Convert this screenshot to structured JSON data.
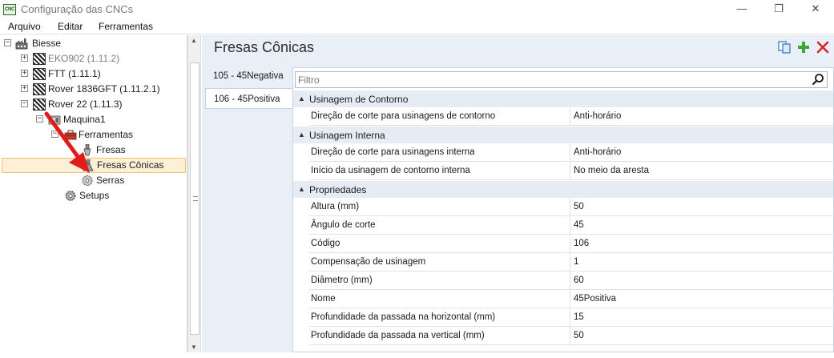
{
  "window": {
    "title": "Configuração das CNCs",
    "app_icon_text": "CNC",
    "minimize_glyph": "—",
    "restore_glyph": "❐",
    "close_glyph": "✕"
  },
  "menu": {
    "items": [
      {
        "label": "Arquivo"
      },
      {
        "label": "Editar"
      },
      {
        "label": "Ferramentas"
      }
    ]
  },
  "tree": {
    "nodes": [
      {
        "label": "Biesse",
        "expander": "−",
        "icon": "factory-icon"
      },
      {
        "label": "EKO902 (1.11.2)",
        "expander": "+",
        "icon": "machine-icon",
        "muted": true
      },
      {
        "label": "FTT (1.11.1)",
        "expander": "+",
        "icon": "machine-icon"
      },
      {
        "label": "Rover 1836GFT (1.11.2.1)",
        "expander": "+",
        "icon": "machine-icon"
      },
      {
        "label": "Rover 22 (1.11.3)",
        "expander": "−",
        "icon": "machine-icon"
      },
      {
        "label": "Maquina1",
        "expander": "−",
        "icon": "machine-config-icon"
      },
      {
        "label": "Ferramentas",
        "expander": "−",
        "icon": "toolbox-icon"
      },
      {
        "label": "Fresas",
        "icon": "router-bit-icon"
      },
      {
        "label": "Fresas Cônicas",
        "icon": "conical-bit-icon",
        "selected": true
      },
      {
        "label": "Serras",
        "icon": "saw-blade-icon"
      },
      {
        "label": "Setups",
        "icon": "gear-icon"
      }
    ]
  },
  "main": {
    "title": "Fresas Cônicas",
    "toolbar": {
      "copy_icon": "copy-icon",
      "add_icon": "add-icon",
      "delete_icon": "delete-icon"
    },
    "side_tabs": [
      {
        "label": "105 - 45Negativa"
      },
      {
        "label": "106 - 45Positiva",
        "active": true
      }
    ],
    "filter_placeholder": "Filtro",
    "categories": [
      {
        "label": "Usinagem de Contorno",
        "rows": [
          {
            "name": "Direção de corte para usinagens de contorno",
            "value": "Anti-horário"
          }
        ]
      },
      {
        "label": "Usinagem Interna",
        "rows": [
          {
            "name": "Direção de corte para usinagens interna",
            "value": "Anti-horário"
          },
          {
            "name": "Início da usinagem de contorno interna",
            "value": "No meio da aresta"
          }
        ]
      },
      {
        "label": "Propriedades",
        "rows": [
          {
            "name": "Altura (mm)",
            "value": "50"
          },
          {
            "name": "Ângulo de corte",
            "value": "45"
          },
          {
            "name": "Código",
            "value": "106"
          },
          {
            "name": "Compensação de usinagem",
            "value": "1"
          },
          {
            "name": "Diâmetro (mm)",
            "value": "60"
          },
          {
            "name": "Nome",
            "value": "45Positiva"
          },
          {
            "name": "Profundidade da passada na horizontal (mm)",
            "value": "15"
          },
          {
            "name": "Profundidade da passada na vertical (mm)",
            "value": "50"
          }
        ]
      }
    ]
  },
  "colors": {
    "accent_panel": "#e9eff6",
    "selection": "#fdf0d6",
    "annotation_arrow": "#e21b1b",
    "add_green": "#3aa835",
    "delete_red": "#d9262a"
  }
}
